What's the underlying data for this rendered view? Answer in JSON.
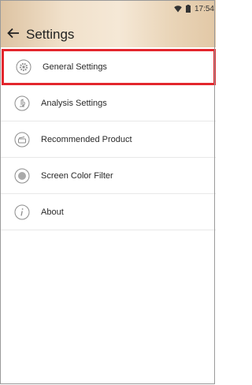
{
  "status_bar": {
    "time": "17:54"
  },
  "header": {
    "title": "Settings"
  },
  "settings_items": [
    {
      "label": "General Settings",
      "icon": "gear-icon",
      "selected": true
    },
    {
      "label": "Analysis Settings",
      "icon": "analysis-icon",
      "selected": false
    },
    {
      "label": "Recommended Product",
      "icon": "product-icon",
      "selected": false
    },
    {
      "label": "Screen Color Filter",
      "icon": "color-filter-icon",
      "selected": false
    },
    {
      "label": "About",
      "icon": "info-icon",
      "selected": false
    }
  ],
  "colors": {
    "highlight": "#e3262d",
    "icon_gray": "#8c8c8c"
  }
}
